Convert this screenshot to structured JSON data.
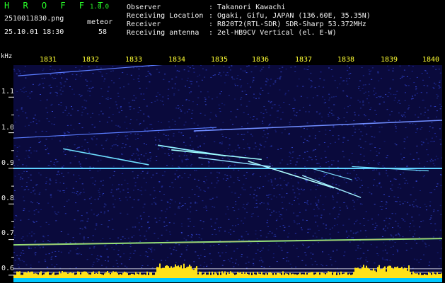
{
  "app": {
    "logo": "H R O F F T",
    "version": "1.0.0"
  },
  "header": {
    "filename": "2510011830.png",
    "datetime": "25.10.01 18:30",
    "meteor_label": "meteor",
    "meteor_count": "58"
  },
  "info": [
    {
      "key": "Observer",
      "value": ": Takanori Kawachi"
    },
    {
      "key": "Receiving Location",
      "value": ": Ogaki, Gifu, JAPAN (136.60E, 35.35N)"
    },
    {
      "key": "Receiver",
      "value": ": R820T2(RTL-SDR) SDR-Sharp 53.372MHz"
    },
    {
      "key": "Receiving antenna",
      "value": ": 2el-HB9CV Vertical (el. E-W)"
    }
  ],
  "axis": {
    "unit": "kHz",
    "y_ticks": [
      "1.1",
      "1.0",
      "0.9",
      "0.8",
      "0.7",
      "0.6"
    ],
    "x_ticks": [
      "1831",
      "1832",
      "1833",
      "1834",
      "1835",
      "1836",
      "1837",
      "1838",
      "1839",
      "1840"
    ]
  },
  "colors": {
    "background": "#0a0a3c",
    "noise": "#1e2a9a",
    "trace": "#6fb7ff",
    "text_green": "#29ff29",
    "text_yellow": "#ffff33",
    "text_white": "#f2f2f2",
    "bar_yellow": "#ffe21a",
    "bar_cyan": "#00c8ff"
  },
  "chart_data": {
    "type": "heatmap",
    "x_unit": "minute (hhmm)",
    "y_unit": "kHz",
    "xlim": [
      1830.5,
      1840.0
    ],
    "ylim": [
      0.58,
      1.19
    ],
    "carriers": [
      {
        "freq": 0.9
      },
      {
        "freq_start": 0.685,
        "freq_end": 0.703
      }
    ],
    "reference_lines": [
      0.618,
      0.608
    ]
  }
}
